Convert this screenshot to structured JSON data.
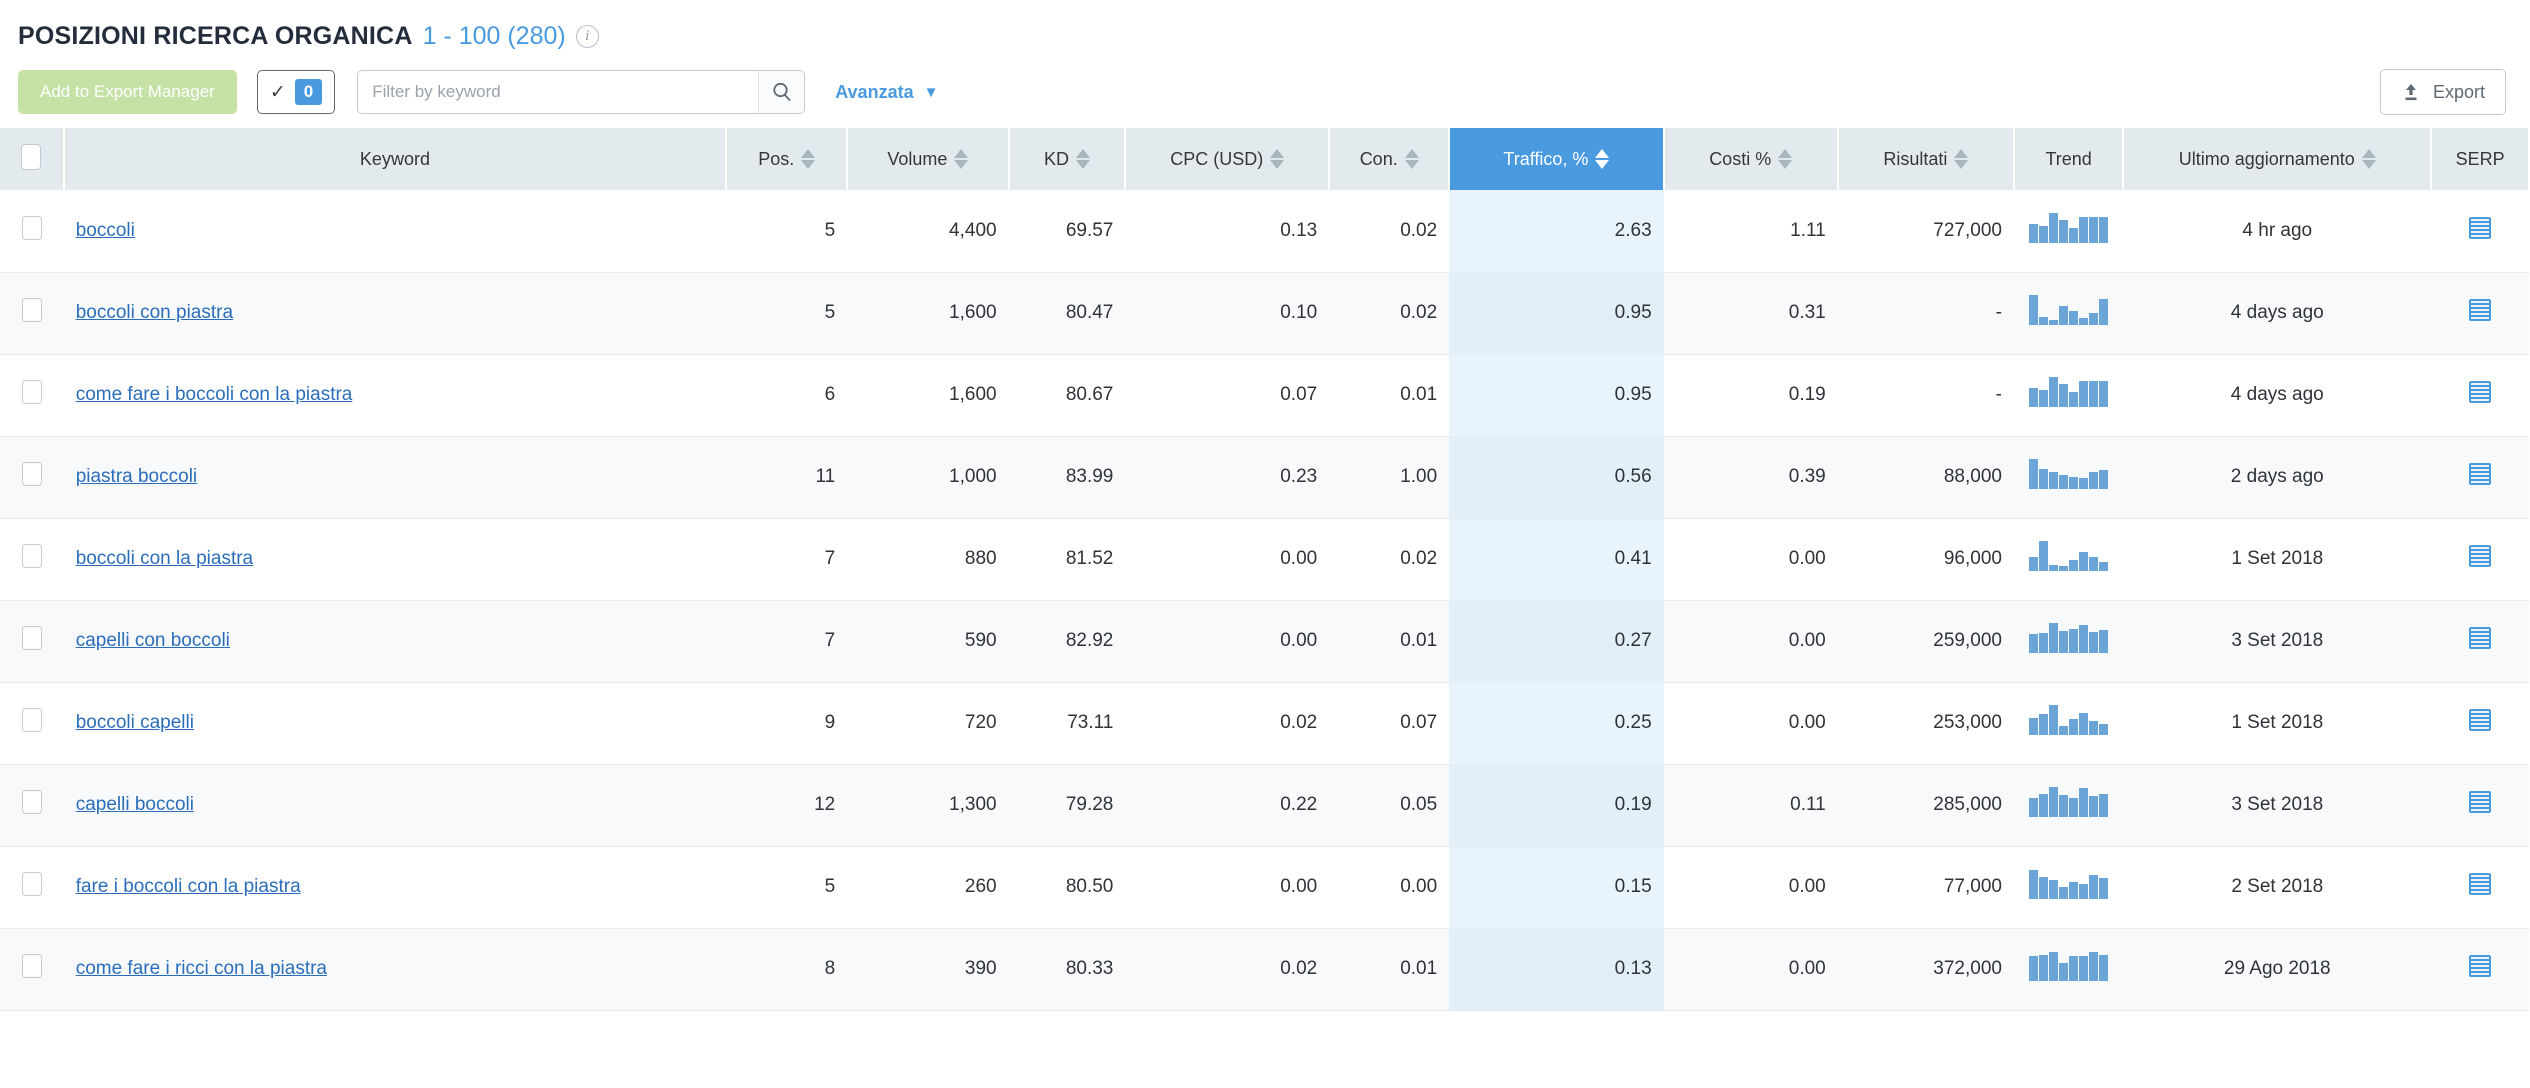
{
  "header": {
    "title": "POSIZIONI RICERCA ORGANICA",
    "count_label": "1 - 100 (280)",
    "info_icon": "info-icon"
  },
  "toolbar": {
    "export_manager_label": "Add to Export Manager",
    "selected_check_glyph": "✓",
    "selected_count": "0",
    "filter_placeholder": "Filter by keyword",
    "filter_value": "",
    "search_icon": "search-icon",
    "advanced_label": "Avanzata",
    "caret_glyph": "▼",
    "export_label": "Export",
    "export_icon": "upload-icon",
    "accent_blue": "#4a9ae0",
    "green_button": "#c5e1a5"
  },
  "table": {
    "columns": [
      {
        "key": "select",
        "label": "",
        "sortable": false,
        "align": "center"
      },
      {
        "key": "keyword",
        "label": "Keyword",
        "sortable": false,
        "align": "center"
      },
      {
        "key": "pos",
        "label": "Pos.",
        "sortable": true,
        "align": "center"
      },
      {
        "key": "volume",
        "label": "Volume",
        "sortable": true,
        "align": "center"
      },
      {
        "key": "kd",
        "label": "KD",
        "sortable": true,
        "align": "center"
      },
      {
        "key": "cpc",
        "label": "CPC (USD)",
        "sortable": true,
        "align": "center"
      },
      {
        "key": "con",
        "label": "Con.",
        "sortable": true,
        "align": "center"
      },
      {
        "key": "traffic",
        "label": "Traffico, %",
        "sortable": true,
        "align": "center",
        "highlighted": true
      },
      {
        "key": "costi",
        "label": "Costi %",
        "sortable": true,
        "align": "center"
      },
      {
        "key": "risult",
        "label": "Risultati",
        "sortable": true,
        "align": "center"
      },
      {
        "key": "trend",
        "label": "Trend",
        "sortable": false,
        "align": "center"
      },
      {
        "key": "updated",
        "label": "Ultimo aggiornamento",
        "sortable": true,
        "align": "center"
      },
      {
        "key": "serp",
        "label": "SERP",
        "sortable": false,
        "align": "center"
      }
    ],
    "rows": [
      {
        "keyword": "boccoli",
        "pos": "5",
        "volume": "4,400",
        "kd": "69.57",
        "cpc": "0.13",
        "con": "0.02",
        "traffic": "2.63",
        "costi": "1.11",
        "risult": "727,000",
        "trend": [
          62,
          55,
          100,
          78,
          50,
          88,
          88,
          88
        ],
        "updated": "4 hr ago"
      },
      {
        "keyword": "boccoli con piastra",
        "pos": "5",
        "volume": "1,600",
        "kd": "80.47",
        "cpc": "0.10",
        "con": "0.02",
        "traffic": "0.95",
        "costi": "0.31",
        "risult": "-",
        "trend": [
          100,
          28,
          18,
          62,
          45,
          22,
          40,
          88
        ],
        "updated": "4 days ago"
      },
      {
        "keyword": "come fare i boccoli con la piastra",
        "pos": "6",
        "volume": "1,600",
        "kd": "80.67",
        "cpc": "0.07",
        "con": "0.01",
        "traffic": "0.95",
        "costi": "0.19",
        "risult": "-",
        "trend": [
          62,
          55,
          100,
          78,
          50,
          88,
          88,
          88
        ],
        "updated": "4 days ago"
      },
      {
        "keyword": "piastra boccoli",
        "pos": "11",
        "volume": "1,000",
        "kd": "83.99",
        "cpc": "0.23",
        "con": "1.00",
        "traffic": "0.56",
        "costi": "0.39",
        "risult": "88,000",
        "trend": [
          100,
          66,
          55,
          48,
          40,
          35,
          55,
          62
        ],
        "updated": "2 days ago"
      },
      {
        "keyword": "boccoli con la piastra",
        "pos": "7",
        "volume": "880",
        "kd": "81.52",
        "cpc": "0.00",
        "con": "0.02",
        "traffic": "0.41",
        "costi": "0.00",
        "risult": "96,000",
        "trend": [
          45,
          100,
          20,
          18,
          38,
          62,
          48,
          30
        ],
        "updated": "1 Set 2018"
      },
      {
        "keyword": "capelli con boccoli",
        "pos": "7",
        "volume": "590",
        "kd": "82.92",
        "cpc": "0.00",
        "con": "0.01",
        "traffic": "0.27",
        "costi": "0.00",
        "risult": "259,000",
        "trend": [
          62,
          68,
          100,
          72,
          80,
          92,
          70,
          78
        ],
        "updated": "3 Set 2018"
      },
      {
        "keyword": "boccoli capelli",
        "pos": "9",
        "volume": "720",
        "kd": "73.11",
        "cpc": "0.02",
        "con": "0.07",
        "traffic": "0.25",
        "costi": "0.00",
        "risult": "253,000",
        "trend": [
          58,
          70,
          100,
          30,
          52,
          72,
          48,
          38
        ],
        "updated": "1 Set 2018"
      },
      {
        "keyword": "capelli boccoli",
        "pos": "12",
        "volume": "1,300",
        "kd": "79.28",
        "cpc": "0.22",
        "con": "0.05",
        "traffic": "0.19",
        "costi": "0.11",
        "risult": "285,000",
        "trend": [
          62,
          75,
          100,
          72,
          62,
          95,
          70,
          75
        ],
        "updated": "3 Set 2018"
      },
      {
        "keyword": "fare i boccoli con la piastra",
        "pos": "5",
        "volume": "260",
        "kd": "80.50",
        "cpc": "0.00",
        "con": "0.00",
        "traffic": "0.15",
        "costi": "0.00",
        "risult": "77,000",
        "trend": [
          95,
          72,
          62,
          40,
          58,
          50,
          80,
          70
        ],
        "updated": "2 Set 2018"
      },
      {
        "keyword": "come fare i ricci con la piastra",
        "pos": "8",
        "volume": "390",
        "kd": "80.33",
        "cpc": "0.02",
        "con": "0.01",
        "traffic": "0.13",
        "costi": "0.00",
        "risult": "372,000",
        "trend": [
          82,
          88,
          95,
          60,
          82,
          82,
          95,
          88
        ],
        "updated": "29 Ago 2018"
      }
    ]
  }
}
